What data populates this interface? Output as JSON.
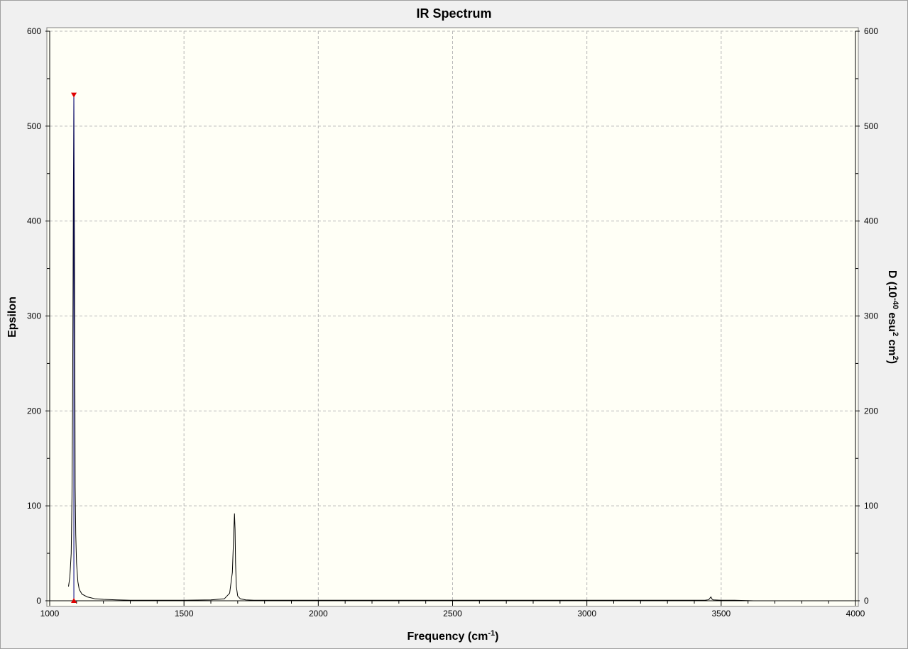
{
  "chart_data": {
    "type": "line",
    "title": "IR Spectrum",
    "xlabel": {
      "main": "Frequency (cm",
      "sup": "-1",
      "tail": ")"
    },
    "ylabel_left": "Epsilon",
    "ylabel_right": {
      "a": "D (10",
      "sup1": "-40",
      "b": " esu",
      "sup2": "2",
      "c": " cm",
      "sup3": "2",
      "d": ")"
    },
    "xlim": [
      1000,
      4000
    ],
    "ylim": [
      0,
      600
    ],
    "x_ticks": [
      1000,
      1500,
      2000,
      2500,
      3000,
      3500,
      4000
    ],
    "y_ticks": [
      0,
      100,
      200,
      300,
      400,
      500,
      600
    ],
    "grid": true,
    "colors": {
      "plot_bg": "#fffff6",
      "spectrum": "#000000",
      "marker": "#e00000",
      "stick": "#000080",
      "grid": "#b8b8b8"
    },
    "spectrum": {
      "name": "",
      "x": [
        1070,
        1075,
        1080,
        1083,
        1085,
        1087,
        1088,
        1089,
        1090,
        1091,
        1092,
        1093,
        1094,
        1095,
        1097,
        1100,
        1105,
        1110,
        1120,
        1140,
        1170,
        1200,
        1250,
        1300,
        1400,
        1500,
        1600,
        1650,
        1670,
        1680,
        1685,
        1688,
        1690,
        1692,
        1695,
        1700,
        1710,
        1730,
        1760,
        1800,
        2000,
        2300,
        2600,
        3000,
        3300,
        3400,
        3440,
        3450,
        3455,
        3460,
        3462,
        3465,
        3470,
        3500,
        3550,
        3600,
        3620
      ],
      "y": [
        15,
        25,
        50,
        110,
        200,
        330,
        420,
        480,
        533,
        450,
        385,
        300,
        200,
        120,
        70,
        40,
        20,
        12,
        7,
        4,
        2,
        1.5,
        1,
        0.5,
        0.5,
        0.5,
        1,
        2,
        8,
        30,
        70,
        92,
        75,
        40,
        15,
        5,
        2,
        1,
        0.5,
        0.5,
        0.5,
        0.5,
        0.5,
        0.5,
        0.5,
        0.5,
        0.5,
        1,
        1.5,
        3.5,
        4,
        2,
        1,
        0.5,
        0.5,
        0.2,
        0
      ]
    },
    "peak_marker": {
      "x": 1090,
      "y": 533
    }
  }
}
